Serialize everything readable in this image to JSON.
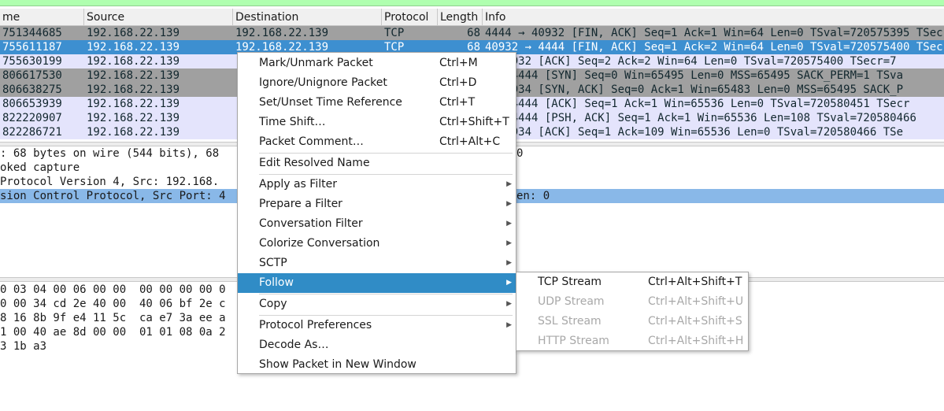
{
  "columns": [
    "me",
    "Source",
    "Destination",
    "Protocol",
    "Length",
    "Info"
  ],
  "packets": [
    {
      "time": "751344685",
      "src": "192.168.22.139",
      "dst": "192.168.22.139",
      "proto": "TCP",
      "len": "68",
      "info": "4444 → 40932 [FIN, ACK] Seq=1 Ack=1 Win=64 Len=0 TSval=720575395 TSec",
      "style": "gray"
    },
    {
      "time": "755611187",
      "src": "192.168.22.139",
      "dst": "192.168.22.139",
      "proto": "TCP",
      "len": "68",
      "info": "40932 → 4444 [FIN, ACK] Seq=1 Ack=2 Win=64 Len=0 TSval=720575400 TSec",
      "style": "selected"
    },
    {
      "time": "755630199",
      "src": "192.168.22.139",
      "dst": "",
      "proto": "",
      "len": "",
      "info": "→ 40932 [ACK] Seq=2 Ack=2 Win=64 Len=0 TSval=720575400 TSecr=7",
      "style": "lavender"
    },
    {
      "time": "806617530",
      "src": "192.168.22.139",
      "dst": "",
      "proto": "",
      "len": "",
      "info": "4 → 4444 [SYN] Seq=0 Win=65495 Len=0 MSS=65495 SACK_PERM=1 TSva",
      "style": "gray"
    },
    {
      "time": "806638275",
      "src": "192.168.22.139",
      "dst": "",
      "proto": "",
      "len": "",
      "info": "→ 40934 [SYN, ACK] Seq=0 Ack=1 Win=65483 Len=0 MSS=65495 SACK_P",
      "style": "gray"
    },
    {
      "time": "806653939",
      "src": "192.168.22.139",
      "dst": "",
      "proto": "",
      "len": "",
      "info": "4 → 4444 [ACK] Seq=1 Ack=1 Win=65536 Len=0 TSval=720580451 TSecr",
      "style": "lavender"
    },
    {
      "time": "822220907",
      "src": "192.168.22.139",
      "dst": "",
      "proto": "",
      "len": "",
      "info": "4 → 4444 [PSH, ACK] Seq=1 Ack=1 Win=65536 Len=108 TSval=720580466",
      "style": "lavender"
    },
    {
      "time": "822286721",
      "src": "192.168.22.139",
      "dst": "",
      "proto": "",
      "len": "",
      "info": "→ 40934 [ACK] Seq=1 Ack=109 Win=65536 Len=0 TSval=720580466 TSe",
      "style": "lavender"
    }
  ],
  "details": [
    {
      "text": ": 68 bytes on wire (544 bits), 68",
      "right": "0",
      "selected": false
    },
    {
      "text": "oked capture",
      "right": "",
      "selected": false
    },
    {
      "text": " Protocol Version 4, Src: 192.168.",
      "right": "",
      "selected": false
    },
    {
      "text": "sion Control Protocol, Src Port: 4",
      "right": "en: 0",
      "selected": true
    }
  ],
  "bytes": [
    "0 03 04 00 06 00 00  00 00 00 00 0",
    "0 00 34 cd 2e 40 00  40 06 bf 2e c",
    "8 16 8b 9f e4 11 5c  ca e7 3a ee a",
    "1 00 40 ae 8d 00 00  01 01 08 0a 2",
    "3 1b a3"
  ],
  "context_menu": {
    "items": [
      {
        "label": "Mark/Unmark Packet",
        "shortcut": "Ctrl+M",
        "submenu": false,
        "active": false
      },
      {
        "label": "Ignore/Unignore Packet",
        "shortcut": "Ctrl+D",
        "submenu": false,
        "active": false
      },
      {
        "label": "Set/Unset Time Reference",
        "shortcut": "Ctrl+T",
        "submenu": false,
        "active": false
      },
      {
        "label": "Time Shift…",
        "shortcut": "Ctrl+Shift+T",
        "submenu": false,
        "active": false
      },
      {
        "label": "Packet Comment…",
        "shortcut": "Ctrl+Alt+C",
        "submenu": false,
        "active": false
      },
      {
        "separator": true
      },
      {
        "label": "Edit Resolved Name",
        "shortcut": "",
        "submenu": false,
        "active": false
      },
      {
        "separator": true
      },
      {
        "label": "Apply as Filter",
        "shortcut": "",
        "submenu": true,
        "active": false
      },
      {
        "label": "Prepare a Filter",
        "shortcut": "",
        "submenu": true,
        "active": false
      },
      {
        "label": "Conversation Filter",
        "shortcut": "",
        "submenu": true,
        "active": false
      },
      {
        "label": "Colorize Conversation",
        "shortcut": "",
        "submenu": true,
        "active": false
      },
      {
        "label": "SCTP",
        "shortcut": "",
        "submenu": true,
        "active": false
      },
      {
        "label": "Follow",
        "shortcut": "",
        "submenu": true,
        "active": true
      },
      {
        "separator": true
      },
      {
        "label": "Copy",
        "shortcut": "",
        "submenu": true,
        "active": false
      },
      {
        "separator": true
      },
      {
        "label": "Protocol Preferences",
        "shortcut": "",
        "submenu": true,
        "active": false
      },
      {
        "label": "Decode As…",
        "shortcut": "",
        "submenu": false,
        "active": false
      },
      {
        "label": "Show Packet in New Window",
        "shortcut": "",
        "submenu": false,
        "active": false
      }
    ]
  },
  "follow_submenu": {
    "items": [
      {
        "label": "TCP Stream",
        "shortcut": "Ctrl+Alt+Shift+T",
        "enabled": true
      },
      {
        "label": "UDP Stream",
        "shortcut": "Ctrl+Alt+Shift+U",
        "enabled": false
      },
      {
        "label": "SSL Stream",
        "shortcut": "Ctrl+Alt+Shift+S",
        "enabled": false
      },
      {
        "label": "HTTP Stream",
        "shortcut": "Ctrl+Alt+Shift+H",
        "enabled": false
      }
    ]
  },
  "icons": {
    "submenu_arrow": "triangle-right-icon"
  },
  "colors": {
    "selected_row": "#3d8fd0",
    "gray_row": "#a0a0a0",
    "lavender_row": "#e4e4fc",
    "menu_highlight": "#308cc6",
    "filter_bar": "#afffaf",
    "detail_selected": "#89b8e8"
  }
}
